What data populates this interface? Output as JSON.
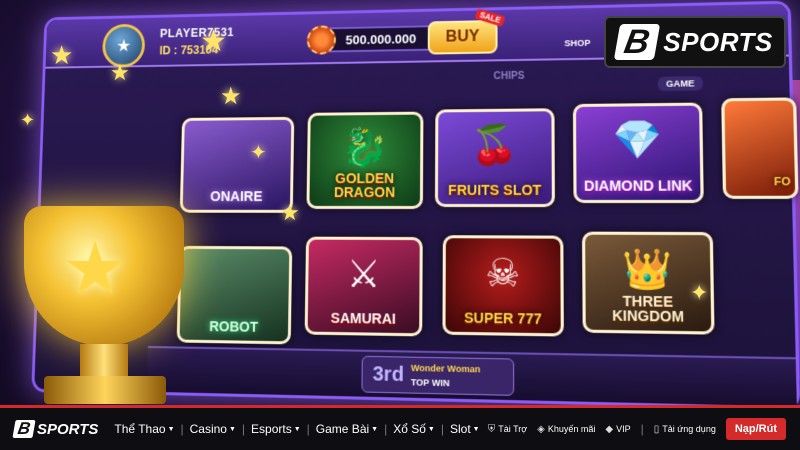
{
  "brand": {
    "letter": "B",
    "name": "SPORTS"
  },
  "lobby": {
    "player_name": "PLAYER7531",
    "player_id": "ID : 753104",
    "balance": "500.000.000",
    "buy_label": "BUY",
    "sale_label": "SALE",
    "shop_label": "SHOP",
    "chips_label": "CHIPS",
    "game_label": "GAME",
    "games": {
      "golden_dragon": "GOLDEN DRAGON",
      "fruits_slot": "FRUITS SLOT",
      "diamond_link": "DIAMOND LINK",
      "samurai": "SAMURAI",
      "super777": "SUPER 777",
      "three_kingdom": "THREE KINGDOM",
      "left_top": "ONAIRE",
      "left_bottom": "ROBOT",
      "right_top": "FO"
    },
    "promo": {
      "rank": "3rd",
      "title": "Wonder Woman",
      "subtitle": "TOP WIN"
    }
  },
  "nav": {
    "items": [
      {
        "label": "Thể Thao"
      },
      {
        "label": "Casino"
      },
      {
        "label": "Esports"
      },
      {
        "label": "Game Bài"
      },
      {
        "label": "Xổ Số"
      },
      {
        "label": "Slot"
      }
    ],
    "utilities": [
      {
        "label": "Tài Trợ",
        "icon": "shield-icon"
      },
      {
        "label": "Khuyến mãi",
        "icon": "tag-icon"
      },
      {
        "label": "VIP",
        "icon": "diamond-icon"
      },
      {
        "label": "Tải ứng dụng",
        "icon": "phone-icon"
      }
    ],
    "cta": "Nạp/Rút"
  },
  "colors": {
    "accent_red": "#d42a2a",
    "lobby_purple": "#8b5cf6",
    "gold": "#ffd84a"
  }
}
